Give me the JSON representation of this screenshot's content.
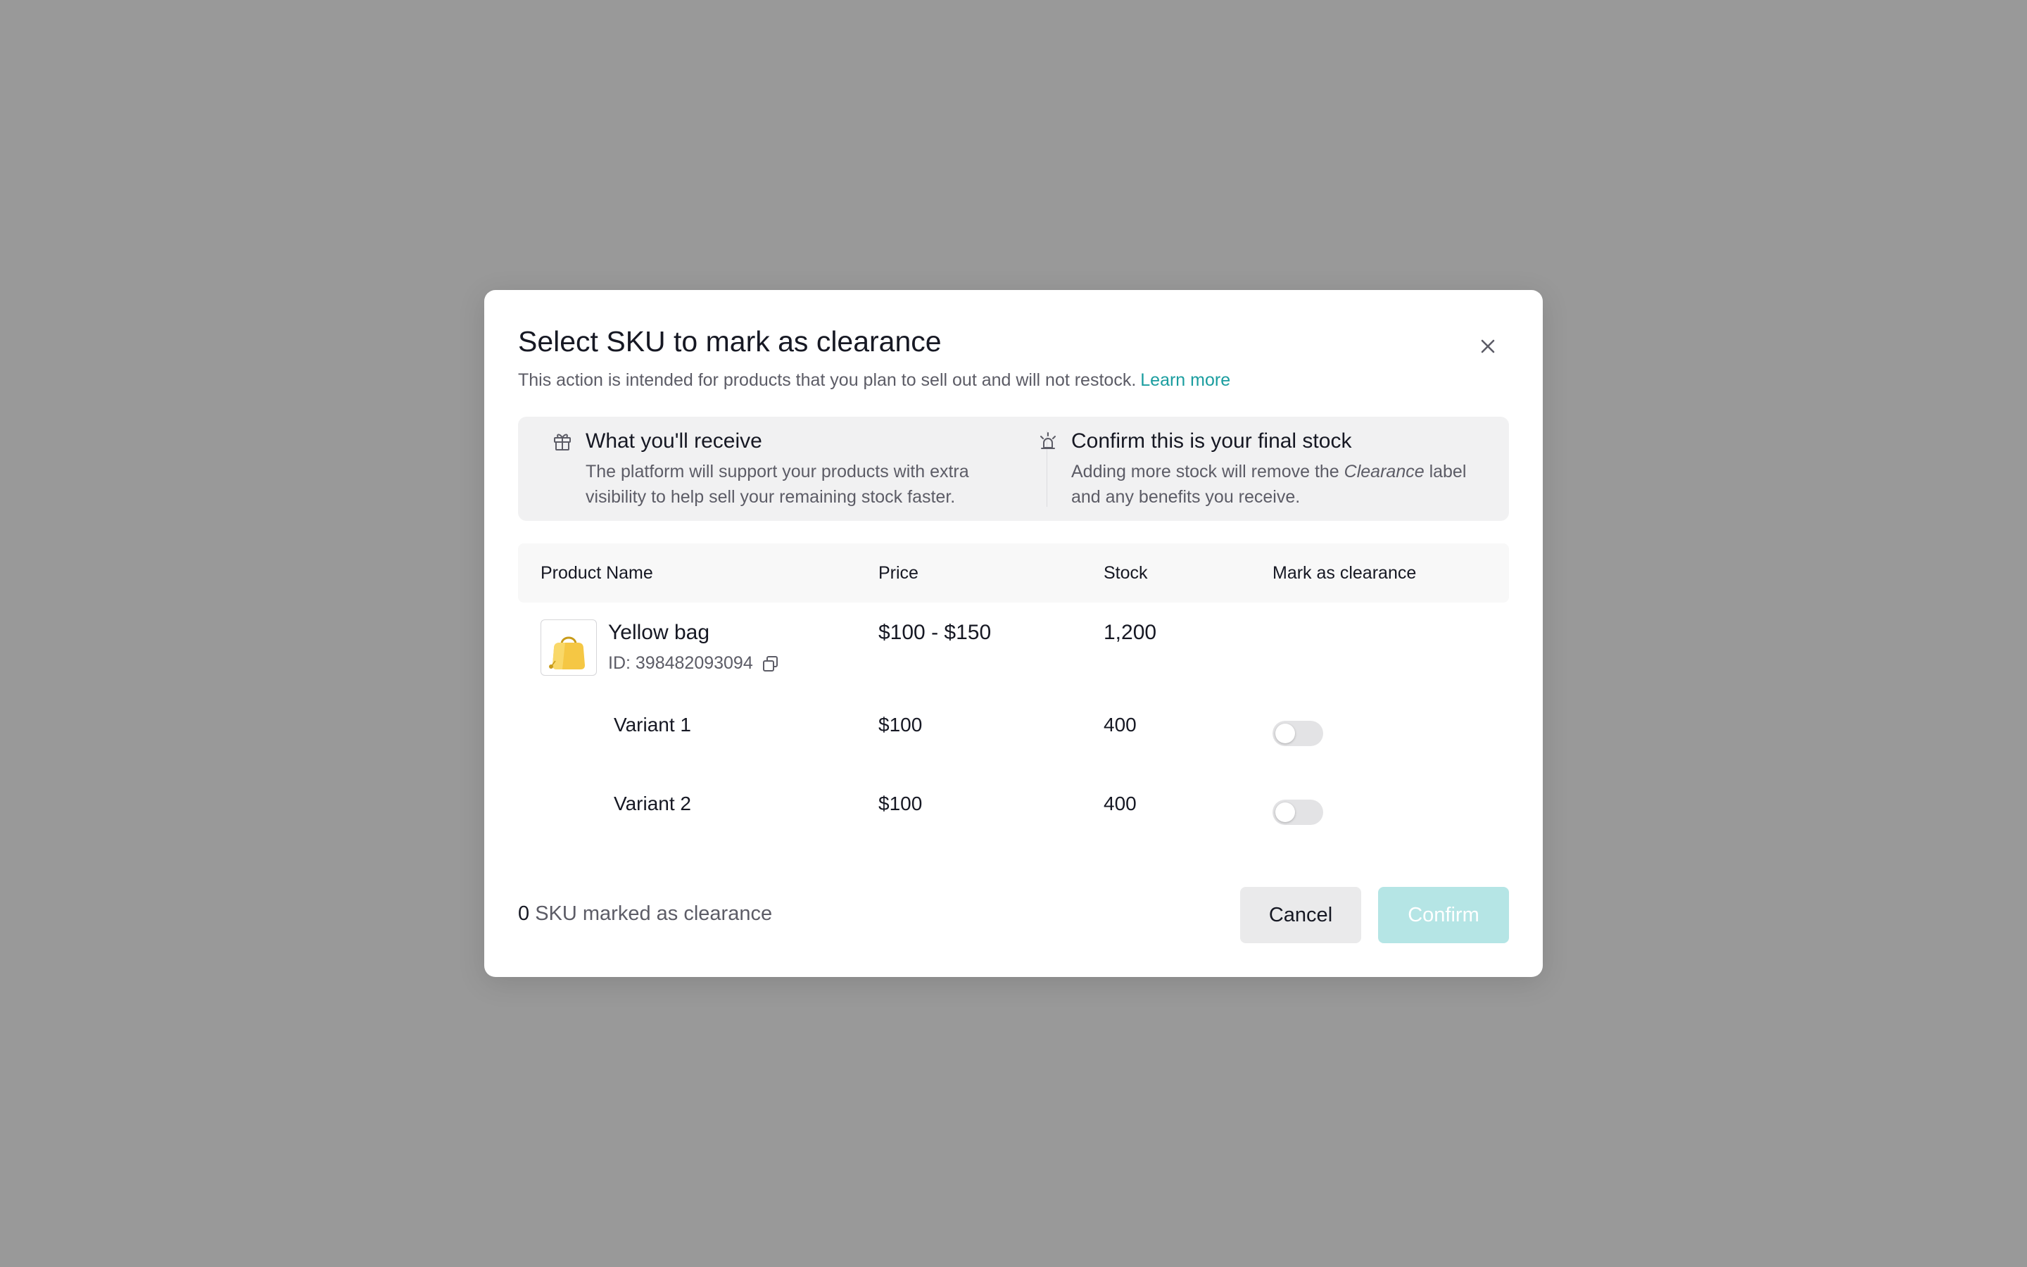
{
  "modal": {
    "title": "Select SKU to mark as clearance",
    "subtitle": "This action is intended for products that you plan to sell out and will not restock.",
    "learn_more": "Learn more"
  },
  "info": {
    "receive": {
      "icon": "gift-icon",
      "title": "What you'll receive",
      "body": "The platform will support your products with extra visibility to help sell your remaining stock faster."
    },
    "final_stock": {
      "icon": "alert-light-icon",
      "title": "Confirm this is your final stock",
      "body_before": "Adding more stock will remove the ",
      "body_em": "Clearance",
      "body_after": " label and any benefits you receive."
    }
  },
  "table": {
    "headers": {
      "product_name": "Product Name",
      "price": "Price",
      "stock": "Stock",
      "mark": "Mark as clearance"
    },
    "product": {
      "name": "Yellow bag",
      "id": "ID: 398482093094",
      "price": "$100 - $150",
      "stock": "1,200",
      "thumbnail": "yellow-bag-image"
    },
    "variants": [
      {
        "name": "Variant 1",
        "price": "$100",
        "stock": "400",
        "clearance": false
      },
      {
        "name": "Variant 2",
        "price": "$100",
        "stock": "400",
        "clearance": false
      }
    ]
  },
  "footer": {
    "count": "0",
    "count_label": "SKU marked as clearance",
    "cancel": "Cancel",
    "confirm": "Confirm"
  },
  "colors": {
    "overlay": "#999999",
    "accent": "#1a9d9f",
    "confirm_disabled": "#b5e5e5"
  }
}
